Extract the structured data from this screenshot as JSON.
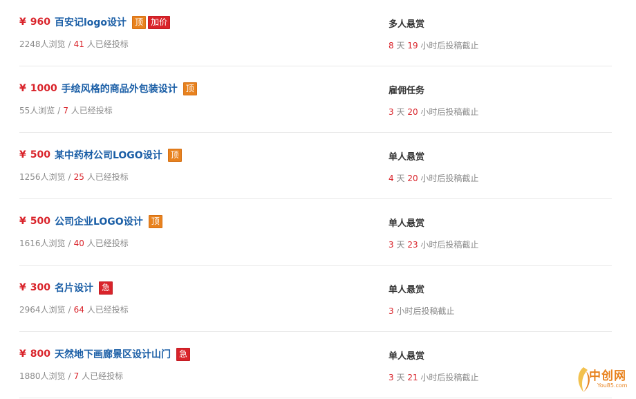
{
  "tasks": [
    {
      "currency": "¥",
      "amount": "960",
      "title": "百安记logo设计",
      "badges": [
        "顶",
        "加价"
      ],
      "views": "2248人浏览",
      "sep": "/",
      "bids": "41",
      "bids_suffix": "人已经投标",
      "type": "多人悬赏",
      "days": "8",
      "days_unit": "天",
      "hours": "19",
      "deadline_suffix": "小时后投稿截止"
    },
    {
      "currency": "¥",
      "amount": "1000",
      "title": "手绘风格的商品外包装设计",
      "badges": [
        "顶"
      ],
      "views": "55人浏览",
      "sep": "/",
      "bids": "7",
      "bids_suffix": "人已经投标",
      "type": "雇佣任务",
      "days": "3",
      "days_unit": "天",
      "hours": "20",
      "deadline_suffix": "小时后投稿截止"
    },
    {
      "currency": "¥",
      "amount": "500",
      "title": "某中药材公司LOGO设计",
      "badges": [
        "顶"
      ],
      "views": "1256人浏览",
      "sep": "/",
      "bids": "25",
      "bids_suffix": "人已经投标",
      "type": "单人悬赏",
      "days": "4",
      "days_unit": "天",
      "hours": "20",
      "deadline_suffix": "小时后投稿截止"
    },
    {
      "currency": "¥",
      "amount": "500",
      "title": "公司企业LOGO设计",
      "badges": [
        "顶"
      ],
      "views": "1616人浏览",
      "sep": "/",
      "bids": "40",
      "bids_suffix": "人已经投标",
      "type": "单人悬赏",
      "days": "3",
      "days_unit": "天",
      "hours": "23",
      "deadline_suffix": "小时后投稿截止"
    },
    {
      "currency": "¥",
      "amount": "300",
      "title": "名片设计",
      "badges": [
        "急"
      ],
      "views": "2964人浏览",
      "sep": "/",
      "bids": "64",
      "bids_suffix": "人已经投标",
      "type": "单人悬赏",
      "days": "",
      "days_unit": "",
      "hours": "3",
      "deadline_suffix": "小时后投稿截止"
    },
    {
      "currency": "¥",
      "amount": "800",
      "title": "天然地下画廊景区设计山门",
      "badges": [
        "急"
      ],
      "views": "1880人浏览",
      "sep": "/",
      "bids": "7",
      "bids_suffix": "人已经投标",
      "type": "单人悬赏",
      "days": "3",
      "days_unit": "天",
      "hours": "21",
      "deadline_suffix": "小时后投稿截止"
    }
  ],
  "watermark": {
    "text": "中创网",
    "sub": "You85.com"
  },
  "colors": {
    "price": "#d9232a",
    "title": "#1a5ea6",
    "badge_top": "#e8821e",
    "badge_red": "#d9232a"
  }
}
